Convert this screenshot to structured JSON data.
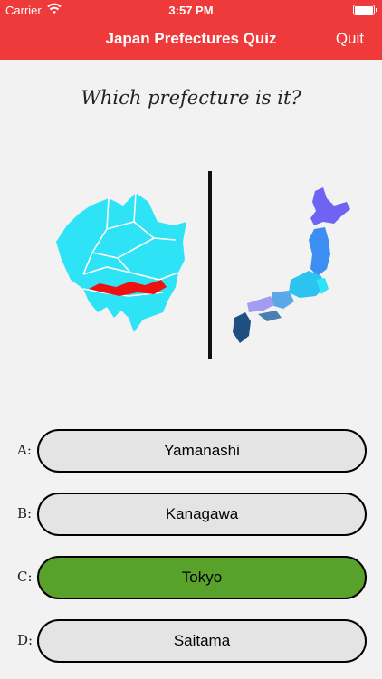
{
  "status": {
    "carrier": "Carrier",
    "time": "3:57 PM"
  },
  "nav": {
    "title": "Japan Prefectures Quiz",
    "quit": "Quit"
  },
  "question": "Which prefecture is it?",
  "answers": [
    {
      "letter": "A:",
      "label": "Yamanashi",
      "state": "default"
    },
    {
      "letter": "B:",
      "label": "Kanagawa",
      "state": "default"
    },
    {
      "letter": "C:",
      "label": "Tokyo",
      "state": "correct"
    },
    {
      "letter": "D:",
      "label": "Saitama",
      "state": "default"
    }
  ],
  "colors": {
    "nav": "#ee3a3a",
    "correct": "#58a22c",
    "button": "#e4e4e4",
    "region": "#2ee3f5",
    "highlight": "#ee1111"
  }
}
